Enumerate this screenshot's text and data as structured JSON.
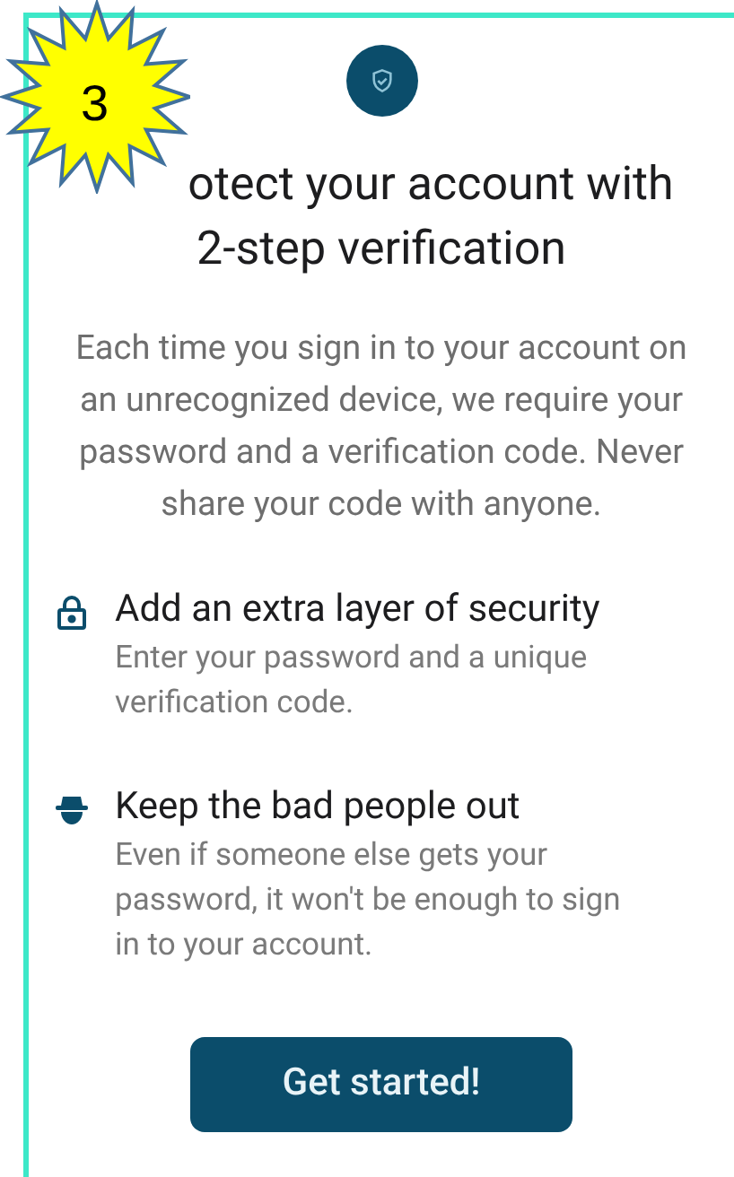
{
  "badge": "3",
  "title_lines": [
    "otect your account with",
    "2-step verification"
  ],
  "intro": "Each time you sign in to your account on an unrecognized device, we require your password and a verification code. Never share your code with anyone.",
  "features": [
    {
      "kind": "lock",
      "heading": "Add an extra layer of security",
      "text": "Enter your password and a unique verification code."
    },
    {
      "kind": "spy",
      "heading": "Keep the bad people out",
      "text": "Even if someone else gets your password, it won't be enough to sign in to your account."
    }
  ],
  "button": "Get started!"
}
